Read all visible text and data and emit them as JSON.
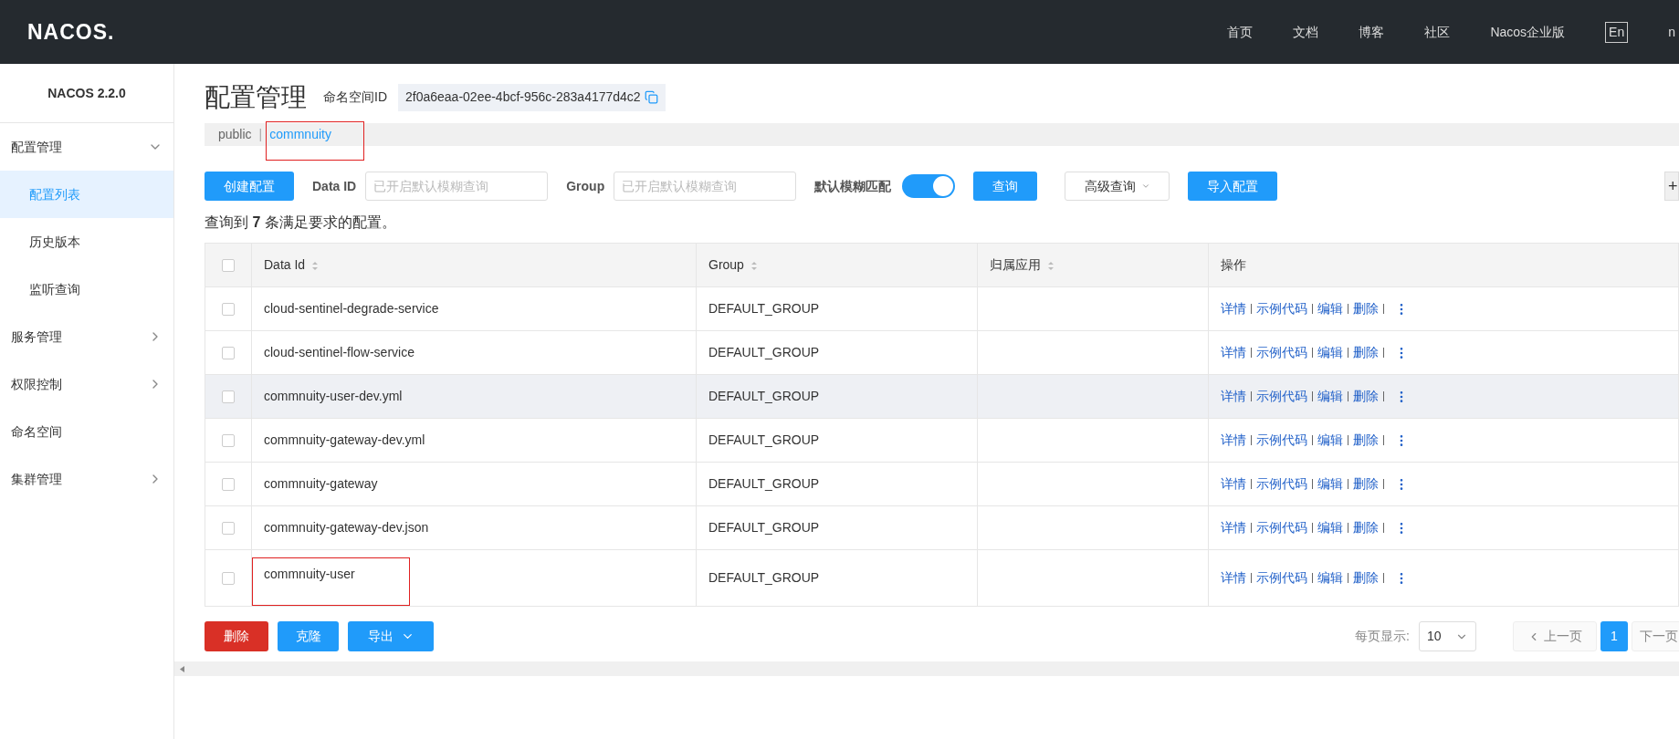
{
  "header": {
    "logo": "NACOS.",
    "nav": [
      "首页",
      "文档",
      "博客",
      "社区",
      "Nacos企业版"
    ],
    "lang": "En",
    "user": "n"
  },
  "sidebar": {
    "version": "NACOS 2.2.0",
    "items": [
      {
        "label": "配置管理",
        "expanded": true,
        "children": [
          {
            "label": "配置列表",
            "selected": true
          },
          {
            "label": "历史版本",
            "selected": false
          },
          {
            "label": "监听查询",
            "selected": false
          }
        ]
      },
      {
        "label": "服务管理",
        "expanded": false
      },
      {
        "label": "权限控制",
        "expanded": false
      },
      {
        "label": "命名空间",
        "kind": "link"
      },
      {
        "label": "集群管理",
        "expanded": false
      }
    ]
  },
  "page": {
    "title": "配置管理",
    "namespace_label": "命名空间ID",
    "namespace_id": "2f0a6eaa-02ee-4bcf-956c-283a4177d4c2",
    "namespace_separator": "|",
    "namespaces": [
      {
        "label": "public",
        "selected": false,
        "annotated": false
      },
      {
        "label": "commnuity",
        "selected": true,
        "annotated": true
      }
    ]
  },
  "toolbar": {
    "create": "创建配置",
    "data_id_label": "Data ID",
    "data_id_placeholder": "已开启默认模糊查询",
    "group_label": "Group",
    "group_placeholder": "已开启默认模糊查询",
    "fuzzy_label": "默认模糊匹配",
    "fuzzy_on": true,
    "search": "查询",
    "advanced": "高级查询",
    "import": "导入配置",
    "more": "+"
  },
  "result": {
    "prefix": "查询到",
    "count": "7",
    "suffix": "条满足要求的配置。"
  },
  "table": {
    "columns": [
      "Data Id",
      "Group",
      "归属应用",
      "操作"
    ],
    "all_checked": false,
    "rows": [
      {
        "data_id": "cloud-sentinel-degrade-service",
        "group": "DEFAULT_GROUP",
        "actions": [
          "详情",
          "示例代码",
          "编辑",
          "删除"
        ],
        "checked": false,
        "hovered": false,
        "annotated": false
      },
      {
        "data_id": "cloud-sentinel-flow-service",
        "group": "DEFAULT_GROUP",
        "actions": [
          "详情",
          "示例代码",
          "编辑",
          "删除"
        ],
        "checked": false,
        "hovered": false,
        "annotated": false
      },
      {
        "data_id": "commnuity-user-dev.yml",
        "group": "DEFAULT_GROUP",
        "actions": [
          "详情",
          "示例代码",
          "编辑",
          "删除"
        ],
        "checked": false,
        "hovered": true,
        "annotated": false
      },
      {
        "data_id": "commnuity-gateway-dev.yml",
        "group": "DEFAULT_GROUP",
        "actions": [
          "详情",
          "示例代码",
          "编辑",
          "删除"
        ],
        "checked": false,
        "hovered": false,
        "annotated": false
      },
      {
        "data_id": "commnuity-gateway",
        "group": "DEFAULT_GROUP",
        "actions": [
          "详情",
          "示例代码",
          "编辑",
          "删除"
        ],
        "checked": false,
        "hovered": false,
        "annotated": false
      },
      {
        "data_id": "commnuity-gateway-dev.json",
        "group": "DEFAULT_GROUP",
        "actions": [
          "详情",
          "示例代码",
          "编辑",
          "删除"
        ],
        "checked": false,
        "hovered": false,
        "annotated": false
      },
      {
        "data_id": "commnuity-user",
        "group": "DEFAULT_GROUP",
        "actions": [
          "详情",
          "示例代码",
          "编辑",
          "删除"
        ],
        "checked": false,
        "hovered": false,
        "annotated": true
      }
    ]
  },
  "footer": {
    "delete": "删除",
    "clone": "克隆",
    "export": "导出",
    "page_size_label": "每页显示:",
    "page_size": "10",
    "prev": "上一页",
    "pages": [
      {
        "label": "1",
        "selected": true
      }
    ],
    "next": "下一页"
  }
}
